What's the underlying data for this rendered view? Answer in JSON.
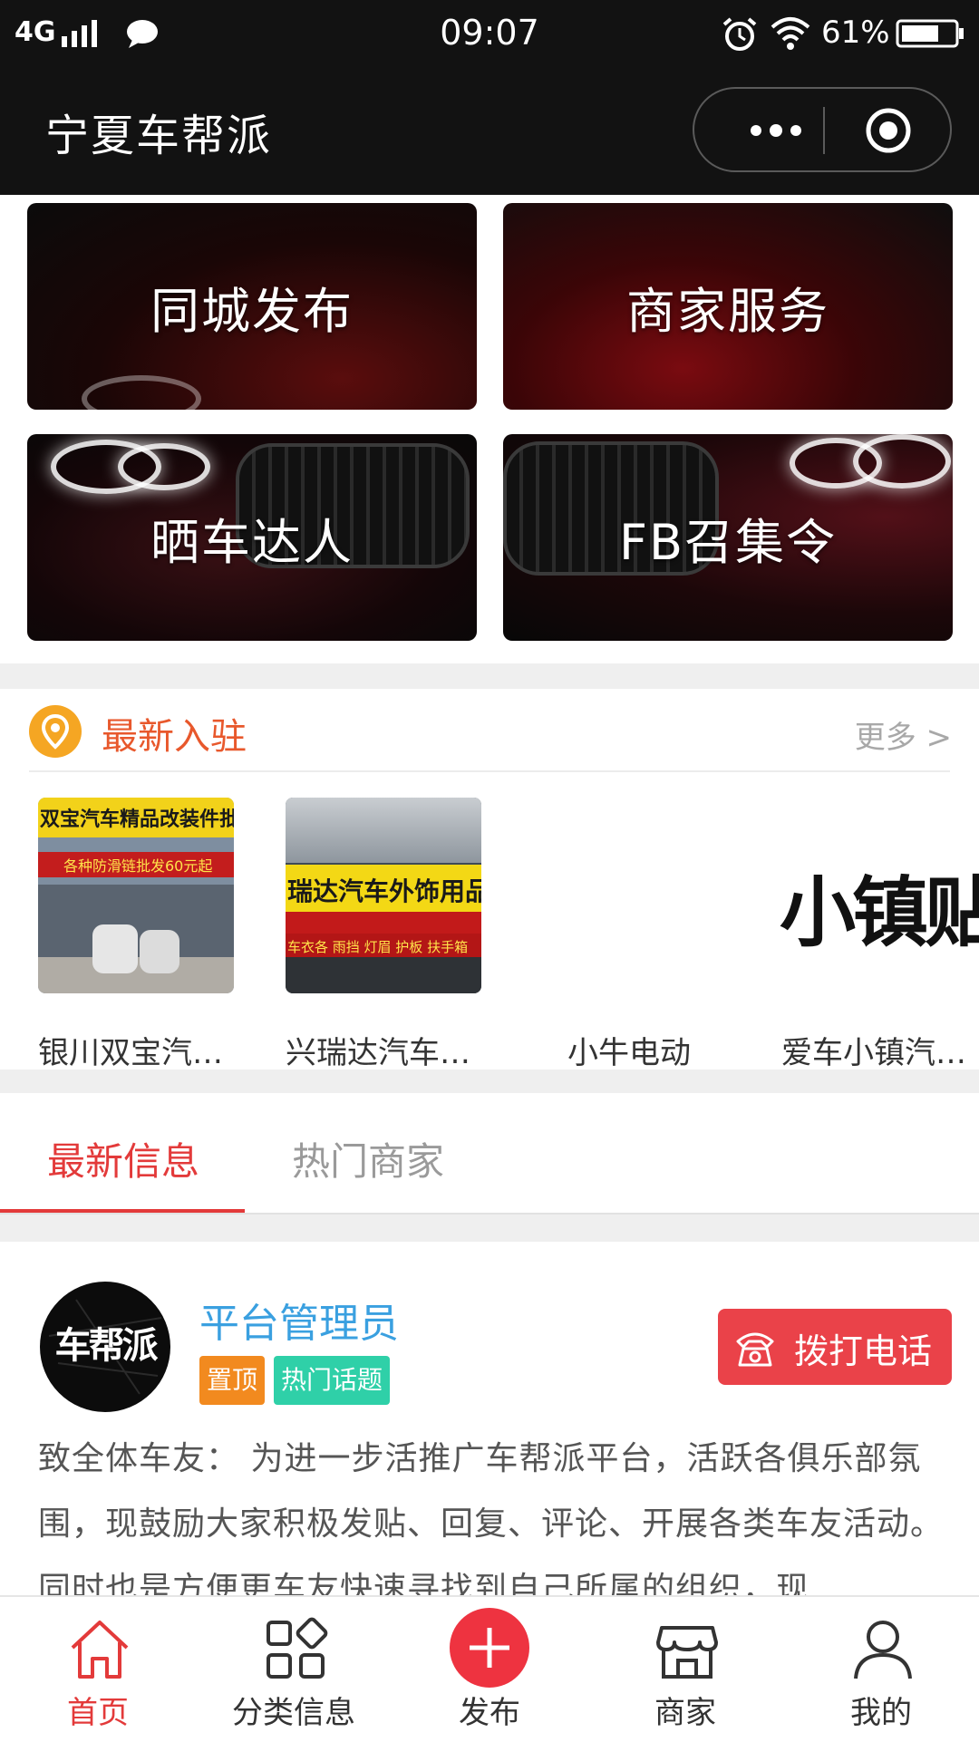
{
  "status_bar": {
    "signal": "4G",
    "time": "09:07",
    "battery": "61%"
  },
  "header": {
    "title": "宁夏车帮派"
  },
  "categories": [
    {
      "label": "同城发布"
    },
    {
      "label": "商家服务"
    },
    {
      "label": "晒车达人"
    },
    {
      "label": "FB召集令"
    }
  ],
  "newest": {
    "title": "最新入驻",
    "more": "更多 >",
    "shops": [
      {
        "name": "银川双宝汽…",
        "sign": "双宝汽车精品改装件批",
        "sub": "各种防滑链批发60元起"
      },
      {
        "name": "兴瑞达汽车…",
        "sign": "瑞达汽车外饰用品",
        "sub": "车衣各 雨挡 灯眉 护板 扶手箱"
      },
      {
        "name": "小牛电动"
      },
      {
        "name": "爱车小镇汽…",
        "sign": "小镇贴"
      }
    ]
  },
  "tabs": [
    {
      "label": "最新信息",
      "active": true
    },
    {
      "label": "热门商家",
      "active": false
    }
  ],
  "post": {
    "author": "平台管理员",
    "avatar_text": "车帮派",
    "tags": [
      "置顶",
      "热门话题"
    ],
    "call_label": "拨打电话",
    "content": "致全体车友： 为进一步活推广车帮派平台，活跃各俱乐部氛围，现鼓励大家积极发贴、回复、评论、开展各类车友活动。同时也是方便更车友快速寻找到自己所属的组织，现…"
  },
  "bottom_nav": [
    {
      "label": "首页",
      "icon": "home-icon",
      "active": true
    },
    {
      "label": "分类信息",
      "icon": "grid-icon",
      "active": false
    },
    {
      "label": "发布",
      "icon": "plus-icon",
      "active": false
    },
    {
      "label": "商家",
      "icon": "shop-icon",
      "active": false
    },
    {
      "label": "我的",
      "icon": "user-icon",
      "active": false
    }
  ],
  "colors": {
    "accent": "#e33a3a",
    "header_bg": "#121212",
    "author_blue": "#3aa0e0",
    "tag_orange": "#f28a1f",
    "tag_green": "#2fd0a8",
    "section_orange": "#e8582c"
  }
}
